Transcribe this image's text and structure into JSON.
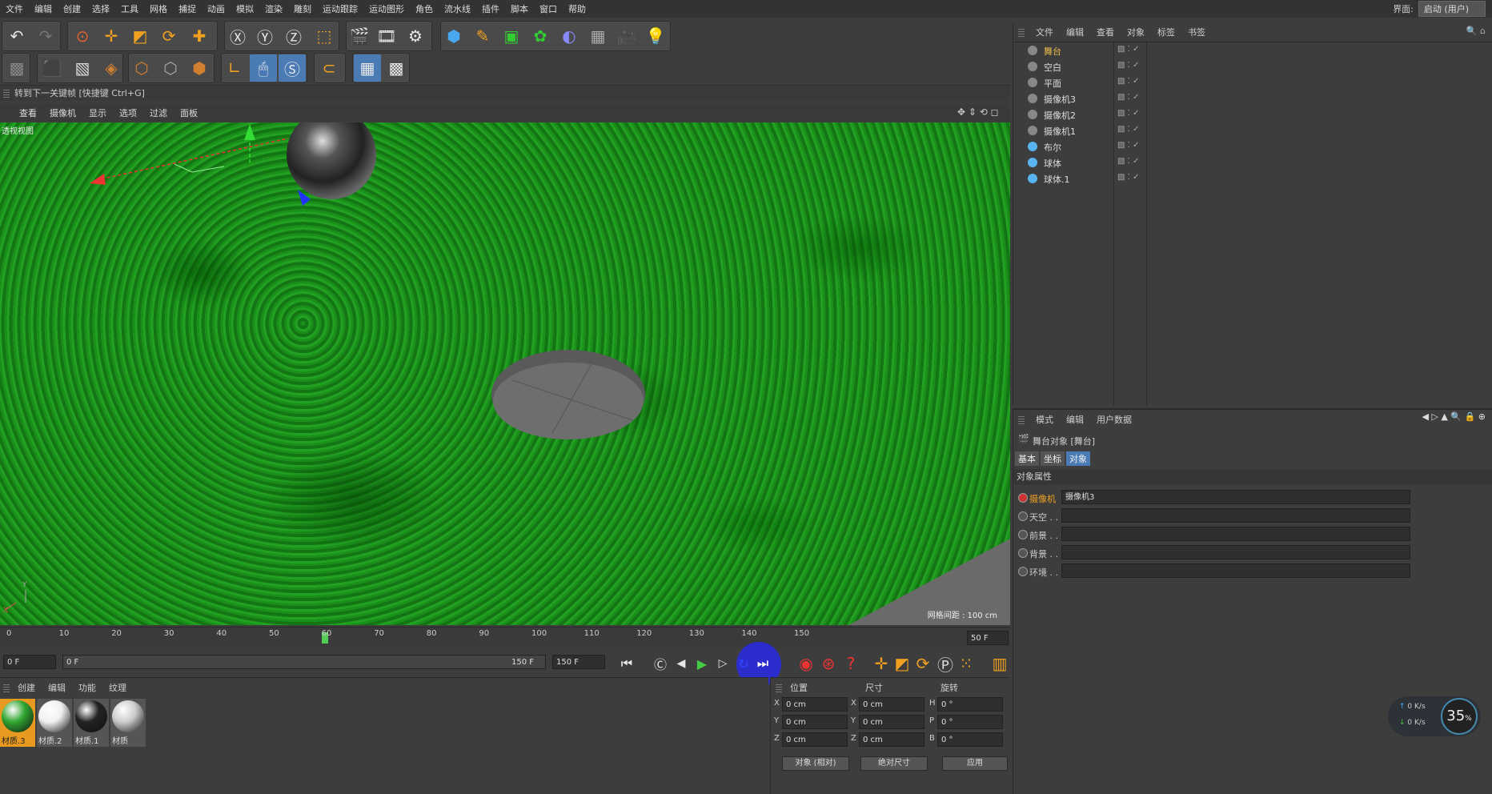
{
  "menu": [
    "文件",
    "编辑",
    "创建",
    "选择",
    "工具",
    "网格",
    "捕捉",
    "动画",
    "模拟",
    "渲染",
    "雕刻",
    "运动跟踪",
    "运动图形",
    "角色",
    "流水线",
    "插件",
    "脚本",
    "窗口",
    "帮助"
  ],
  "layout": {
    "label": "界面:",
    "value": "启动 (用户)"
  },
  "hint": "转到下一关键帧 [快捷键 Ctrl+G]",
  "viewport_menu": [
    "查看",
    "摄像机",
    "显示",
    "选项",
    "过滤",
    "面板"
  ],
  "viewport": {
    "label": "透视视图",
    "grid": "网格间距 : 100 cm"
  },
  "timeline": {
    "ticks": [
      "0",
      "10",
      "20",
      "30",
      "40",
      "50",
      "60",
      "70",
      "80",
      "90",
      "100",
      "110",
      "120",
      "130",
      "140",
      "150"
    ],
    "current_frame_display": "50 F",
    "current_frame": 50
  },
  "transport": {
    "start": "0 F",
    "range_start": "0 F",
    "range_end": "150 F",
    "end": "150 F"
  },
  "material_menu": [
    "创建",
    "编辑",
    "功能",
    "纹理"
  ],
  "materials": [
    {
      "name": "材质.3",
      "color": "#2fa52f"
    },
    {
      "name": "材质.2",
      "color": "#f0f0f0"
    },
    {
      "name": "材质.1",
      "color": "#222"
    },
    {
      "name": "材质",
      "color": "#ccc"
    }
  ],
  "coords": {
    "headers": [
      "位置",
      "尺寸",
      "旋转"
    ],
    "rows": [
      {
        "axis1": "X",
        "pos": "0 cm",
        "axis2": "X",
        "size": "0 cm",
        "axis3": "H",
        "rot": "0 °"
      },
      {
        "axis1": "Y",
        "pos": "0 cm",
        "axis2": "Y",
        "size": "0 cm",
        "axis3": "P",
        "rot": "0 °"
      },
      {
        "axis1": "Z",
        "pos": "0 cm",
        "axis2": "Z",
        "size": "0 cm",
        "axis3": "B",
        "rot": "0 °"
      }
    ],
    "mode": "对象 (相对)",
    "size_mode": "绝对尺寸",
    "apply": "应用"
  },
  "object_menu": [
    "文件",
    "编辑",
    "查看",
    "对象",
    "标签",
    "书签"
  ],
  "objects": [
    {
      "name": "舞台",
      "color": "#e8b84b"
    },
    {
      "name": "空白",
      "color": "#ddd"
    },
    {
      "name": "平面",
      "color": "#ddd"
    },
    {
      "name": "摄像机3",
      "color": "#ddd"
    },
    {
      "name": "摄像机2",
      "color": "#ddd"
    },
    {
      "name": "摄像机1",
      "color": "#ddd"
    },
    {
      "name": "布尔",
      "color": "#ddd"
    },
    {
      "name": "球体",
      "color": "#ddd"
    },
    {
      "name": "球体.1",
      "color": "#ddd"
    }
  ],
  "attr_menu": [
    "模式",
    "编辑",
    "用户数据"
  ],
  "attr": {
    "title": "舞台对象 [舞台]",
    "tabs": [
      "基本",
      "坐标",
      "对象"
    ],
    "section": "对象属性",
    "fields": [
      {
        "label": "摄像机",
        "value": "摄像机3"
      },
      {
        "label": "天空 . . .",
        "value": ""
      },
      {
        "label": "前景 . . .",
        "value": ""
      },
      {
        "label": "背景 . . .",
        "value": ""
      },
      {
        "label": "环境 . . .",
        "value": ""
      }
    ]
  },
  "net": {
    "up": "0 K/s",
    "down": "0 K/s",
    "percent": "35",
    "unit": "%"
  }
}
